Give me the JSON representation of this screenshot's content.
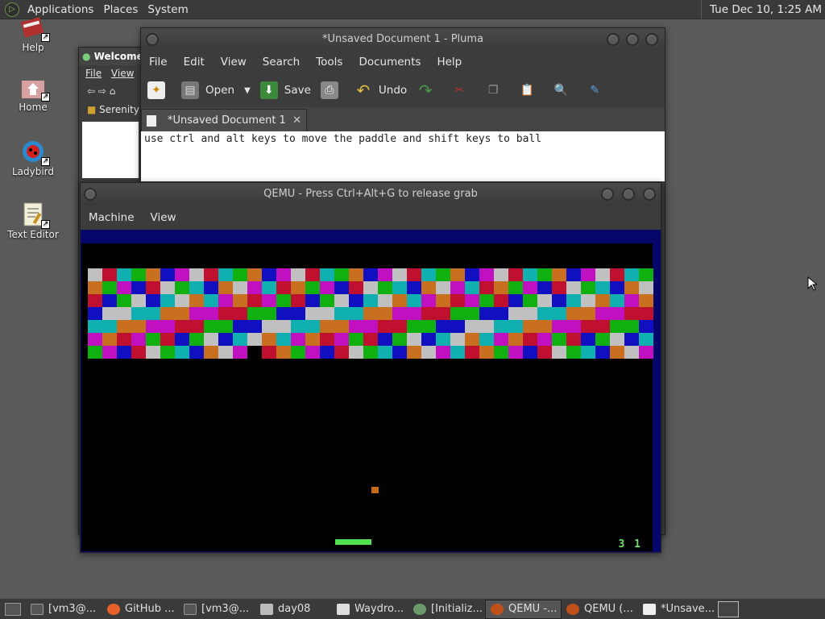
{
  "top_panel": {
    "menus": [
      "Applications",
      "Places",
      "System"
    ],
    "clock": "Tue Dec 10,  1:25 AM"
  },
  "desktop_icons": [
    {
      "label": "Help",
      "icon": "help-book-icon"
    },
    {
      "label": "Home",
      "icon": "home-folder-icon"
    },
    {
      "label": "Ladybird",
      "icon": "ladybird-browser-icon"
    },
    {
      "label": "Text Editor",
      "icon": "text-editor-icon"
    }
  ],
  "welcome_window": {
    "title": "Welcome!",
    "menu": [
      "File",
      "View"
    ],
    "tab": "Serenity"
  },
  "pluma": {
    "title": "*Unsaved Document 1 - Pluma",
    "menu": [
      "File",
      "Edit",
      "View",
      "Search",
      "Tools",
      "Documents",
      "Help"
    ],
    "toolbar": {
      "open": "Open",
      "save": "Save",
      "undo": "Undo"
    },
    "tab_label": "*Unsaved Document 1",
    "content": "use ctrl and alt keys to move the paddle and shift keys to ball"
  },
  "qemu": {
    "title": "QEMU - Press Ctrl+Alt+G to release grab",
    "menu": [
      "Machine",
      "View"
    ],
    "game": {
      "score": "3 1",
      "colors": {
        "gray": "#c0c0c0",
        "orange": "#c87020",
        "green": "#10b010",
        "magenta": "#c010c0",
        "blue": "#1010c0",
        "red": "#c01030",
        "teal": "#10b0b0"
      }
    }
  },
  "taskbar": {
    "items": [
      {
        "label": "[vm3@...",
        "icon": "terminal-icon"
      },
      {
        "label": "GitHub ...",
        "icon": "firefox-icon"
      },
      {
        "label": "[vm3@...",
        "icon": "terminal-icon"
      },
      {
        "label": "day08",
        "icon": "folder-icon"
      },
      {
        "label": "Waydro...",
        "icon": "window-icon"
      },
      {
        "label": "[Initializ...",
        "icon": "app-icon"
      },
      {
        "label": "QEMU -...",
        "icon": "qemu-icon"
      },
      {
        "label": "QEMU (...",
        "icon": "qemu-icon"
      },
      {
        "label": "*Unsave...",
        "icon": "pluma-icon"
      }
    ]
  }
}
